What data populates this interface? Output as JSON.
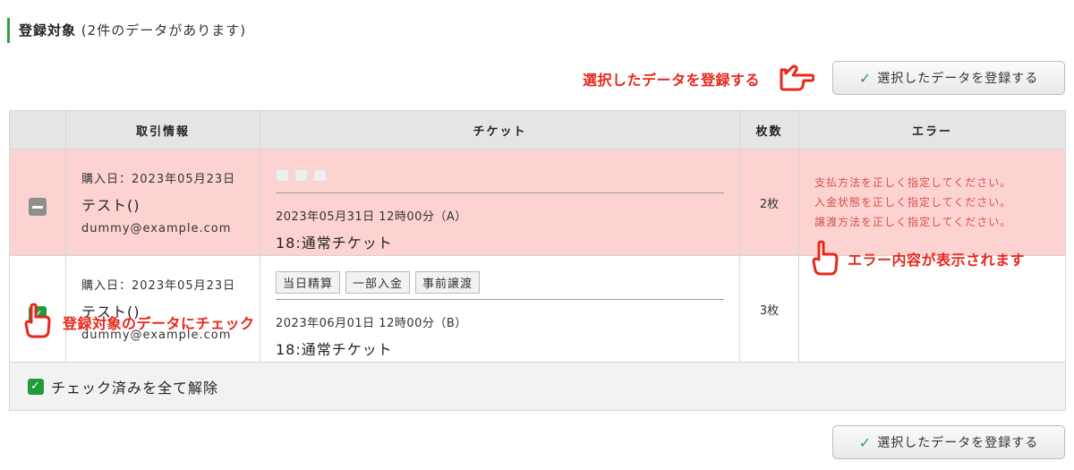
{
  "section": {
    "title": "登録対象",
    "count_text": "(2件のデータがあります)"
  },
  "buttons": {
    "register_label": "選択したデータを登録する"
  },
  "annotations": {
    "top": "選択したデータを登録する",
    "left": "登録対象のデータにチェック",
    "right": "エラー内容が表示されます"
  },
  "table": {
    "headers": [
      "",
      "取引情報",
      "チケット",
      "枚数",
      "エラー"
    ],
    "rows": [
      {
        "state": "error",
        "purchase_date": "購入日：2023年05月23日",
        "name": "テスト()",
        "email": "dummy@example.com",
        "ticket_datetime": "2023年05月31日 12時00分（A）",
        "ticket_name": "18:通常チケット",
        "quantity": "2枚",
        "errors": [
          "支払方法を正しく指定してください。",
          "入金状態を正しく指定してください。",
          "譲渡方法を正しく指定してください。"
        ]
      },
      {
        "state": "checked",
        "purchase_date": "購入日：2023年05月23日",
        "name": "テスト()",
        "email": "dummy@example.com",
        "tags": [
          "当日精算",
          "一部入金",
          "事前譲渡"
        ],
        "ticket_datetime": "2023年06月01日 12時00分（B）",
        "ticket_name": "18:通常チケット",
        "quantity": "3枚"
      }
    ],
    "footer_label": "チェック済みを全て解除"
  },
  "colors": {
    "accent_green": "#1f9d3a",
    "error_row": "#fdd3d2",
    "annotation_red": "#e8271c",
    "error_text": "#d8504a"
  }
}
